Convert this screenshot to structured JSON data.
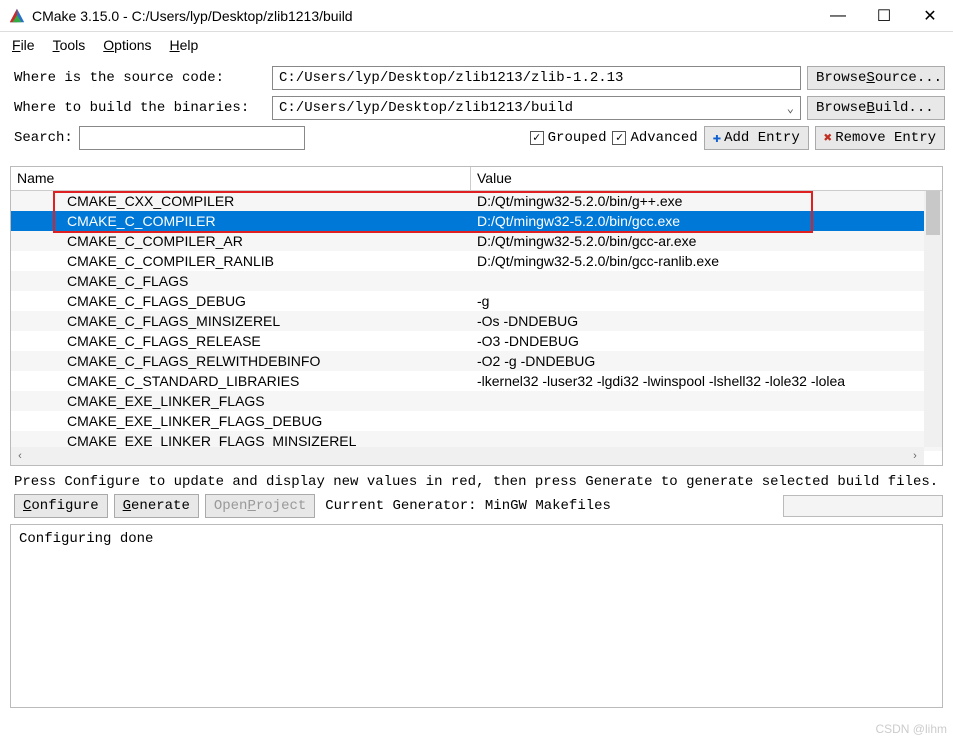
{
  "window": {
    "title": "CMake 3.15.0 - C:/Users/lyp/Desktop/zlib1213/build"
  },
  "menu": {
    "file": "File",
    "tools": "Tools",
    "options": "Options",
    "help": "Help"
  },
  "form": {
    "source_label": "Where is the source code:",
    "source_value": "C:/Users/lyp/Desktop/zlib1213/zlib-1.2.13",
    "browse_source": "Browse Source...",
    "binaries_label": "Where to build the binaries:",
    "binaries_value": "C:/Users/lyp/Desktop/zlib1213/build",
    "browse_build": "Browse Build...",
    "search_label": "Search:",
    "grouped_label": "Grouped",
    "advanced_label": "Advanced",
    "add_entry": "Add Entry",
    "remove_entry": "Remove Entry"
  },
  "table": {
    "header_name": "Name",
    "header_value": "Value",
    "rows": [
      {
        "name": "CMAKE_CXX_COMPILER",
        "value": "D:/Qt/mingw32-5.2.0/bin/g++.exe",
        "selected": false
      },
      {
        "name": "CMAKE_C_COMPILER",
        "value": "D:/Qt/mingw32-5.2.0/bin/gcc.exe",
        "selected": true
      },
      {
        "name": "CMAKE_C_COMPILER_AR",
        "value": "D:/Qt/mingw32-5.2.0/bin/gcc-ar.exe",
        "selected": false
      },
      {
        "name": "CMAKE_C_COMPILER_RANLIB",
        "value": "D:/Qt/mingw32-5.2.0/bin/gcc-ranlib.exe",
        "selected": false
      },
      {
        "name": "CMAKE_C_FLAGS",
        "value": "",
        "selected": false
      },
      {
        "name": "CMAKE_C_FLAGS_DEBUG",
        "value": "-g",
        "selected": false
      },
      {
        "name": "CMAKE_C_FLAGS_MINSIZEREL",
        "value": "-Os -DNDEBUG",
        "selected": false
      },
      {
        "name": "CMAKE_C_FLAGS_RELEASE",
        "value": "-O3 -DNDEBUG",
        "selected": false
      },
      {
        "name": "CMAKE_C_FLAGS_RELWITHDEBINFO",
        "value": "-O2 -g -DNDEBUG",
        "selected": false
      },
      {
        "name": "CMAKE_C_STANDARD_LIBRARIES",
        "value": "-lkernel32 -luser32 -lgdi32 -lwinspool -lshell32 -lole32 -lolea",
        "selected": false
      },
      {
        "name": "CMAKE_EXE_LINKER_FLAGS",
        "value": "",
        "selected": false
      },
      {
        "name": "CMAKE_EXE_LINKER_FLAGS_DEBUG",
        "value": "",
        "selected": false
      },
      {
        "name": "CMAKE_EXE_LINKER_FLAGS_MINSIZEREL",
        "value": "",
        "selected": false
      }
    ]
  },
  "hint": "Press Configure to update and display new values in red, then press Generate to generate selected build files.",
  "actions": {
    "configure": "Configure",
    "generate": "Generate",
    "open_project": "Open Project",
    "generator_text": "Current Generator: MinGW Makefiles"
  },
  "output": "Configuring done",
  "watermark": "CSDN @lihm"
}
